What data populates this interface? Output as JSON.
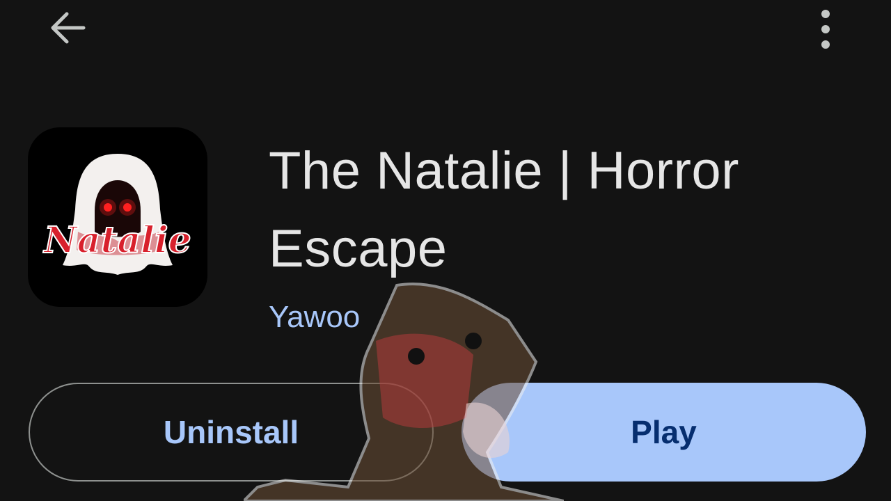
{
  "header": {
    "back_icon": "arrow-left-icon",
    "more_icon": "more-vertical-icon"
  },
  "app": {
    "icon_wordmark": "Natalie",
    "title": "The Natalie | Horror Escape",
    "developer": "Yawoo"
  },
  "actions": {
    "uninstall_label": "Uninstall",
    "play_label": "Play"
  },
  "colors": {
    "background": "#131313",
    "title_text": "#e6e6e6",
    "accent": "#a8c7fa",
    "play_text": "#062e6f",
    "outline": "#8e918f"
  }
}
